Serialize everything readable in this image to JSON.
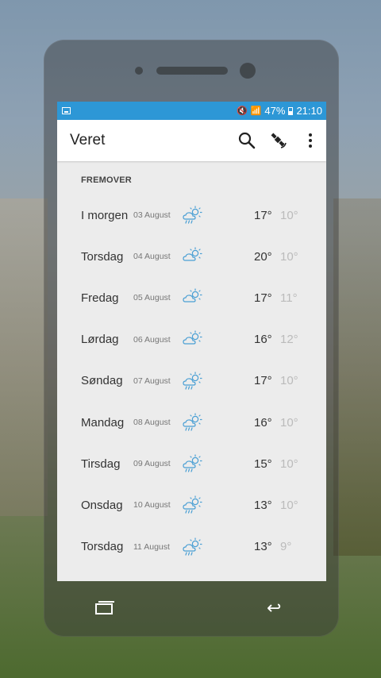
{
  "status": {
    "battery": "47%",
    "time": "21:10"
  },
  "appbar": {
    "title": "Veret",
    "icons": [
      "search-icon",
      "satellite-icon",
      "more-vert-icon"
    ]
  },
  "section": "FREMOVER",
  "forecast": [
    {
      "day": "I morgen",
      "date": "03 August",
      "icon": "partly-cloudy-rain-icon",
      "hi": "17°",
      "lo": "10°"
    },
    {
      "day": "Torsdag",
      "date": "04 August",
      "icon": "partly-cloudy-icon",
      "hi": "20°",
      "lo": "10°"
    },
    {
      "day": "Fredag",
      "date": "05 August",
      "icon": "partly-cloudy-icon",
      "hi": "17°",
      "lo": "11°"
    },
    {
      "day": "Lørdag",
      "date": "06 August",
      "icon": "partly-cloudy-icon",
      "hi": "16°",
      "lo": "12°"
    },
    {
      "day": "Søndag",
      "date": "07 August",
      "icon": "partly-cloudy-rain-icon",
      "hi": "17°",
      "lo": "10°"
    },
    {
      "day": "Mandag",
      "date": "08 August",
      "icon": "partly-cloudy-rain-icon",
      "hi": "16°",
      "lo": "10°"
    },
    {
      "day": "Tirsdag",
      "date": "09 August",
      "icon": "partly-cloudy-rain-icon",
      "hi": "15°",
      "lo": "10°"
    },
    {
      "day": "Onsdag",
      "date": "10 August",
      "icon": "partly-cloudy-rain-icon",
      "hi": "13°",
      "lo": "10°"
    },
    {
      "day": "Torsdag",
      "date": "11 August",
      "icon": "partly-cloudy-rain-icon",
      "hi": "13°",
      "lo": "9°"
    }
  ],
  "colors": {
    "status_bar": "#2d97d6",
    "icon_blue": "#4a9fd4"
  }
}
